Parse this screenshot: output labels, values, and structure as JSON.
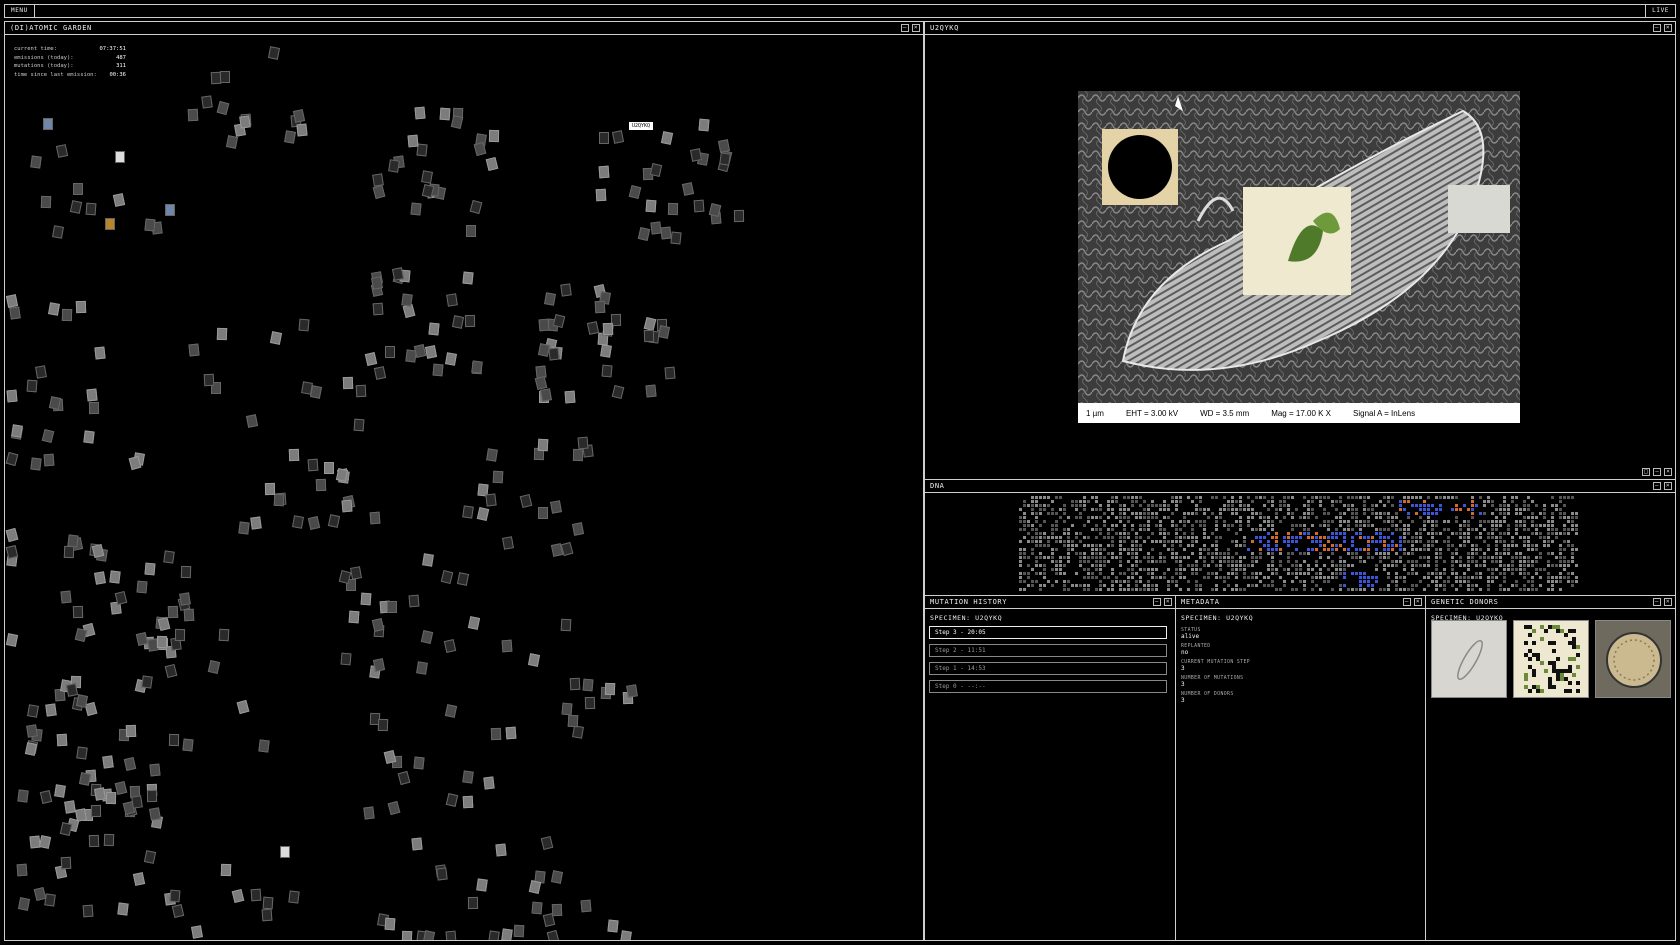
{
  "topbar": {
    "menu_label": "MENU",
    "live_label": "LIVE"
  },
  "garden": {
    "title": "(DI)ATOMIC GARDEN",
    "stats": [
      {
        "label": "current time:",
        "value": "07:37:51"
      },
      {
        "label": "emissions (today):",
        "value": "487"
      },
      {
        "label": "mutations (today):",
        "value": "311"
      },
      {
        "label": "time since last emission:",
        "value": "00:36"
      }
    ],
    "selected_tag": "U2QYKQ"
  },
  "viewer": {
    "title": "U2QYKQ",
    "sem": {
      "scale": "1 µm",
      "eht": "EHT =  3.00 kV",
      "wd": "WD =  3.5 mm",
      "mag": "Mag =   17.00 K X",
      "signal": "Signal A = InLens"
    }
  },
  "dna": {
    "title": "DNA"
  },
  "mutation_history": {
    "title": "MUTATION HISTORY",
    "specimen": "SPECIMEN: U2QYKQ",
    "steps": [
      "Step 3 - 20:05",
      "Step 2 - 11:51",
      "Step 1 - 14:53",
      "Step 0 - --:--"
    ]
  },
  "metadata": {
    "title": "METADATA",
    "specimen": "SPECIMEN: U2QYKQ",
    "fields": [
      {
        "key": "STATUS",
        "value": "alive"
      },
      {
        "key": "REPLANTED",
        "value": "no"
      },
      {
        "key": "CURRENT MUTATION STEP",
        "value": "3"
      },
      {
        "key": "NUMBER OF MUTATIONS",
        "value": "3"
      },
      {
        "key": "NUMBER OF DONORS",
        "value": "3"
      }
    ]
  },
  "donors": {
    "title": "GENETIC DONORS",
    "specimen": "SPECIMEN: U2QYKQ"
  },
  "colors": {
    "accent_blue": "#3a55d8",
    "accent_orange": "#d46a2a",
    "frame": "#cfcfcf"
  }
}
